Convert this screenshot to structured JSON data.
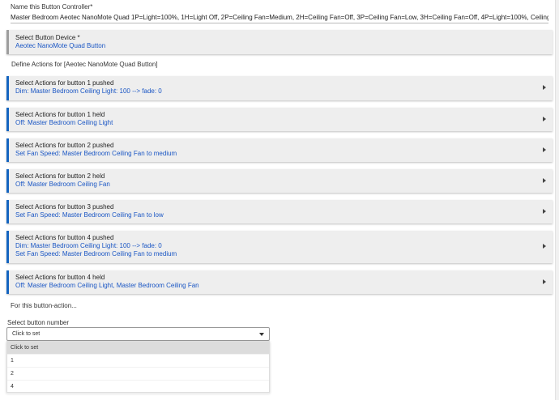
{
  "name_controller": {
    "label": "Name this Button Controller*",
    "value": "Master Bedroom Aeotec NanoMote Quad 1P=Light=100%, 1H=Light Off, 2P=Ceiling Fan=Medium, 2H=Ceiling Fan=Off, 3P=Ceiling Fan=Low, 3H=Ceiling Fan=Off, 4P=Light=100%, Ceiling Fa"
  },
  "device": {
    "title": "Select Button Device *",
    "value": "Aeotec NanoMote Quad Button"
  },
  "define_label": "Define Actions for [Aeotec NanoMote Quad Button]",
  "actions": [
    {
      "title": "Select Actions for button 1 pushed",
      "values": [
        "Dim: Master Bedroom Ceiling Light: 100 --> fade: 0"
      ]
    },
    {
      "title": "Select Actions for button 1 held",
      "values": [
        "Off: Master Bedroom Ceiling Light"
      ]
    },
    {
      "title": "Select Actions for button 2 pushed",
      "values": [
        "Set Fan Speed: Master Bedroom Ceiling Fan to medium"
      ]
    },
    {
      "title": "Select Actions for button 2 held",
      "values": [
        "Off: Master Bedroom Ceiling Fan"
      ]
    },
    {
      "title": "Select Actions for button 3 pushed",
      "values": [
        "Set Fan Speed: Master Bedroom Ceiling Fan to low"
      ]
    },
    {
      "title": "Select Actions for button 4 pushed",
      "values": [
        "Dim: Master Bedroom Ceiling Light: 100 --> fade: 0",
        "Set Fan Speed: Master Bedroom Ceiling Fan to medium"
      ]
    },
    {
      "title": "Select Actions for button 4 held",
      "values": [
        "Off: Master Bedroom Ceiling Light, Master Bedroom Ceiling Fan"
      ]
    }
  ],
  "for_label": "For this button-action...",
  "button_select": {
    "label": "Select button number",
    "value": "Click to set",
    "options": [
      "Click to set",
      "1",
      "2",
      "4"
    ]
  },
  "icons": {
    "row_arrow": "chevron-right-icon",
    "select_caret": "chevron-down-icon"
  },
  "colors": {
    "accent": "#1565c0",
    "link": "#1a56c4",
    "panel": "#eeeeee"
  }
}
